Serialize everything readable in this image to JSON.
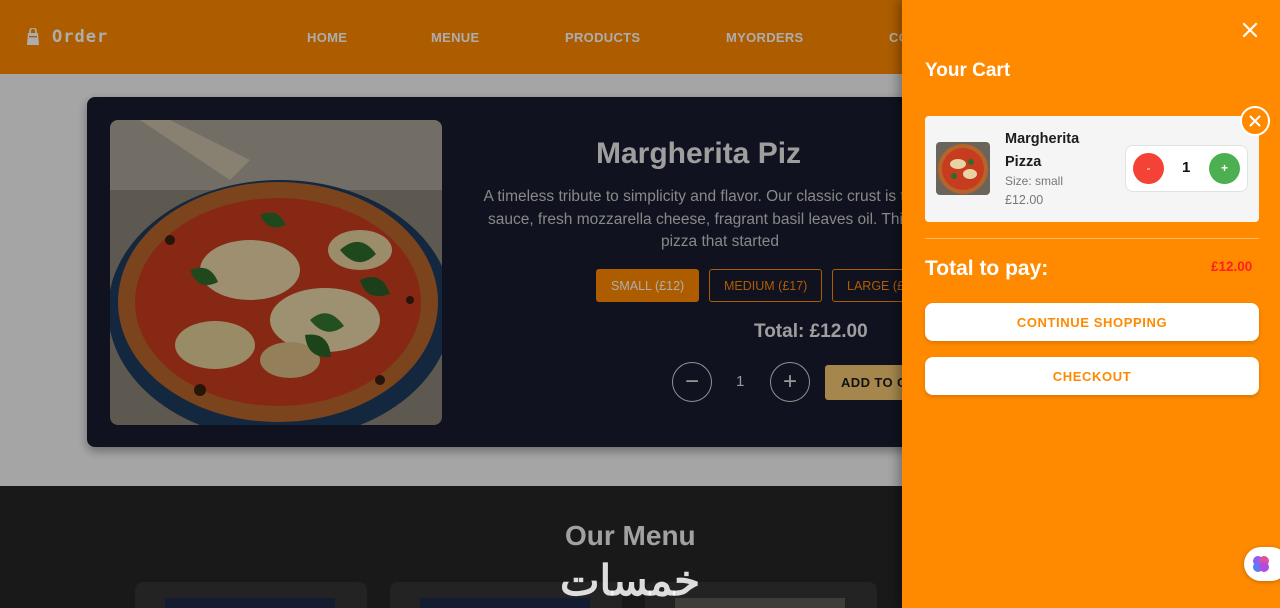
{
  "navbar": {
    "brand": "Order",
    "links": [
      "HOME",
      "MENUE",
      "PRODUCTS",
      "MYORDERS",
      "CO"
    ]
  },
  "product": {
    "title": "Margherita Piz",
    "description": "A timeless tribute to simplicity and flavor. Our classic crust is t tomato sauce, fresh mozzarella cheese, fragrant basil leaves oil. This is the pizza that started",
    "sizes": [
      "SMALL (£12)",
      "MEDIUM (£17)",
      "LARGE (£"
    ],
    "selected_size": "SMALL (£12)",
    "total": "Total: £12.00",
    "quantity": "1",
    "minus_symbol": "−",
    "plus_symbol": "+",
    "add_to_cart": "ADD TO C"
  },
  "menu": {
    "title": "Our Menu"
  },
  "watermark": "خمسات",
  "cart": {
    "title": "Your Cart",
    "items": [
      {
        "name": "Margherita Pizza",
        "size": "Size: small",
        "price": "£12.00",
        "quantity": "1",
        "minus": "-",
        "plus": "+"
      }
    ],
    "total_label": "Total to pay:",
    "total_amount": "£12.00",
    "continue_button": "CONTINUE SHOPPING",
    "checkout_button": "CHECKOUT"
  },
  "colors": {
    "accent": "#ff8a00",
    "card_bg": "#181b2e",
    "total_red": "#ff1f1f",
    "minus_red": "#f44336",
    "plus_green": "#4caf50"
  },
  "icons": [
    "bag-icon",
    "close-icon",
    "remove-item-icon",
    "brain-icon"
  ]
}
